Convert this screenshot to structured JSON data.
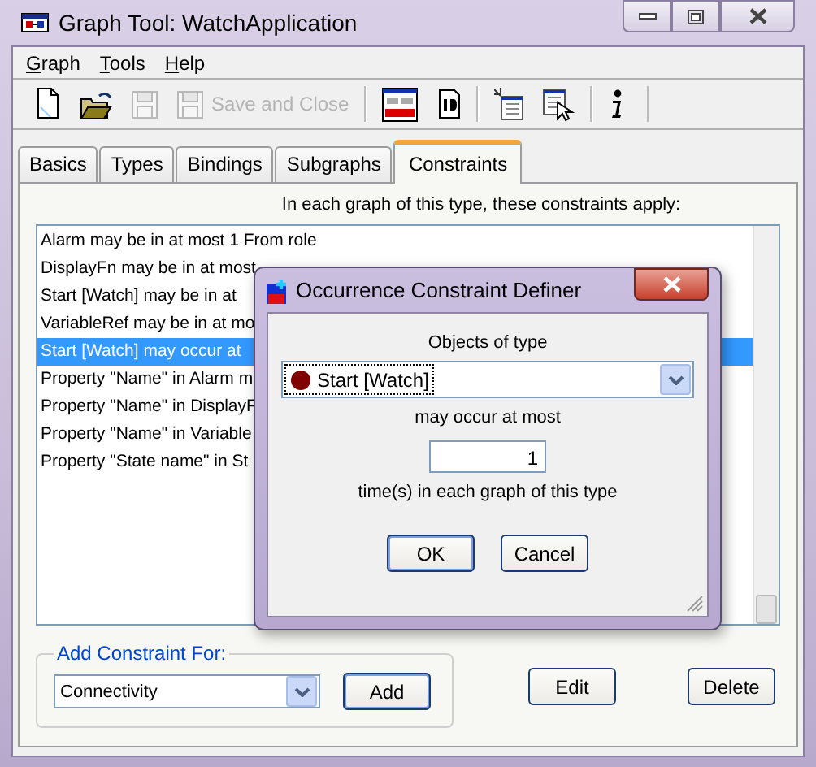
{
  "window": {
    "title": "Graph Tool: WatchApplication"
  },
  "menu": [
    {
      "label": "Graph"
    },
    {
      "label": "Tools"
    },
    {
      "label": "Help"
    }
  ],
  "toolbar": [
    {
      "disabled": false
    },
    {
      "disabled": false
    },
    {
      "disabled": true
    },
    {
      "label": "Save and Close",
      "disabled": true
    },
    {
      "disabled": false
    },
    {
      "disabled": false
    },
    {
      "disabled": false
    },
    {
      "disabled": false
    },
    {
      "disabled": false
    }
  ],
  "tabs": [
    {
      "label": "Basics",
      "selected": false
    },
    {
      "label": "Types",
      "selected": false
    },
    {
      "label": "Bindings",
      "selected": false
    },
    {
      "label": "Subgraphs",
      "selected": false
    },
    {
      "label": "Constraints",
      "selected": true
    }
  ],
  "constraints": {
    "heading": "In each graph of this type, these constraints apply:",
    "items": [
      {
        "text": "Alarm may be in at most 1 From role",
        "selected": false
      },
      {
        "text": "DisplayFn may be in at most",
        "selected": false
      },
      {
        "text": "Start [Watch] may be in at",
        "selected": false
      },
      {
        "text": "VariableRef may be in at mo",
        "selected": false
      },
      {
        "text": "Start [Watch] may occur at",
        "selected": true
      },
      {
        "text": "Property \"Name\" in Alarm m",
        "selected": false
      },
      {
        "text": "Property \"Name\" in DisplayF",
        "selected": false
      },
      {
        "text": "Property \"Name\" in Variable",
        "selected": false
      },
      {
        "text": "Property \"State name\" in St",
        "selected": false
      }
    ]
  },
  "add_constraint": {
    "legend": "Add Constraint For:",
    "value": "Connectivity",
    "add_button": "Add"
  },
  "edit_button": "Edit",
  "delete_button": "Delete",
  "dialog": {
    "title": "Occurrence Constraint Definer",
    "objects_label": "Objects of type",
    "type_value": {
      "label": "Start [Watch]",
      "color": "#800000"
    },
    "occur_label": "may occur at most",
    "count": "1",
    "times_label": "time(s) in each graph of this type",
    "ok_button": "OK",
    "cancel_button": "Cancel"
  }
}
